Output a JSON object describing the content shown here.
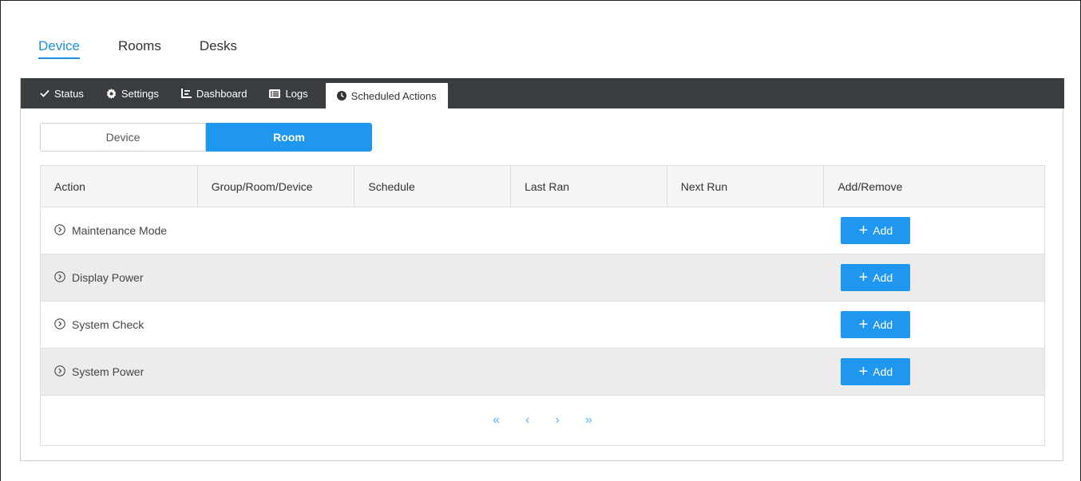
{
  "top_tabs": [
    {
      "label": "Device",
      "active": true
    },
    {
      "label": "Rooms",
      "active": false
    },
    {
      "label": "Desks",
      "active": false
    }
  ],
  "tabs": [
    {
      "label": "Status",
      "icon": "check-icon"
    },
    {
      "label": "Settings",
      "icon": "gear-icon"
    },
    {
      "label": "Dashboard",
      "icon": "dashboard-icon"
    },
    {
      "label": "Logs",
      "icon": "list-icon"
    },
    {
      "label": "Scheduled Actions",
      "icon": "clock-icon",
      "active": true
    }
  ],
  "segment": {
    "left": "Device",
    "right": "Room",
    "selected": "Room"
  },
  "table": {
    "headers": [
      "Action",
      "Group/Room/Device",
      "Schedule",
      "Last Ran",
      "Next Run",
      "Add/Remove"
    ],
    "rows": [
      {
        "action": "Maintenance Mode",
        "button": "Add"
      },
      {
        "action": "Display Power",
        "button": "Add"
      },
      {
        "action": "System Check",
        "button": "Add"
      },
      {
        "action": "System Power",
        "button": "Add"
      }
    ]
  },
  "pager": {
    "first": "«",
    "prev": "‹",
    "next": "›",
    "last": "»"
  },
  "colors": {
    "accent": "#1f97f0",
    "tabbar": "#3a3d40"
  }
}
